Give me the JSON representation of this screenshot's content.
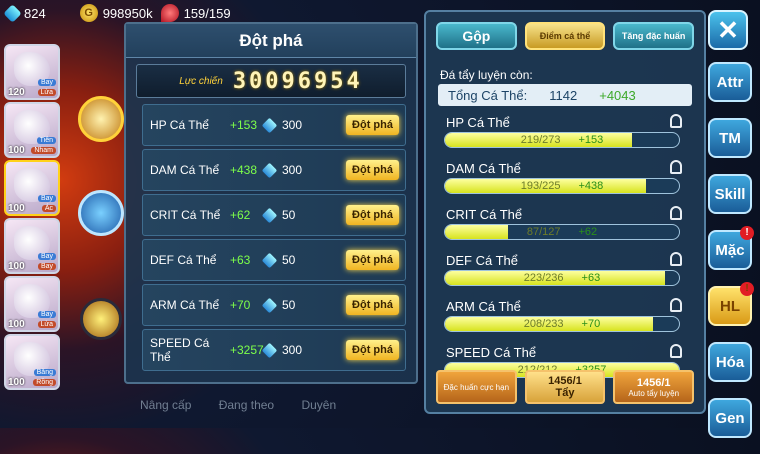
{
  "top": {
    "gems": "824",
    "gold": "998950k",
    "stamina": "159/159"
  },
  "team": [
    {
      "level": "120",
      "tag1": "Bay",
      "tag2": "Lửa"
    },
    {
      "level": "100",
      "tag1": "Tiên",
      "tag2": "Nham"
    },
    {
      "level": "100",
      "tag1": "Bay",
      "tag2": "Ác"
    },
    {
      "level": "100",
      "tag1": "Bay",
      "tag2": "Bay"
    },
    {
      "level": "100",
      "tag1": "Bay",
      "tag2": "Lửa"
    },
    {
      "level": "100",
      "tag1": "Băng",
      "tag2": "Rồng"
    }
  ],
  "left": {
    "title": "Đột phá",
    "power_label": "Lực chiến",
    "power": "30096954",
    "rows": [
      {
        "stat": "HP Cá Thể",
        "plus": "+153",
        "cost": "300",
        "btn": "Đột phá"
      },
      {
        "stat": "DAM Cá Thể",
        "plus": "+438",
        "cost": "300",
        "btn": "Đột phá"
      },
      {
        "stat": "CRIT Cá Thể",
        "plus": "+62",
        "cost": "50",
        "btn": "Đột phá"
      },
      {
        "stat": "DEF Cá Thể",
        "plus": "+63",
        "cost": "50",
        "btn": "Đột phá"
      },
      {
        "stat": "ARM Cá Thể",
        "plus": "+70",
        "cost": "50",
        "btn": "Đột phá"
      },
      {
        "stat": "SPEED Cá Thể",
        "plus": "+3257",
        "cost": "300",
        "btn": "Đột phá"
      }
    ],
    "nav": [
      "Nâng cấp",
      "Đang theo",
      "Duyên"
    ]
  },
  "right": {
    "tabs": [
      "Gộp",
      "Điểm cá thể",
      "Tăng đặc huấn"
    ],
    "heading": "Đá tẩy luyện còn:",
    "total_label": "Tổng Cá Thể:",
    "total": "1142",
    "total_plus": "+4043",
    "stats": [
      {
        "name": "HP Cá Thể",
        "val": "219/273",
        "plus": "+153",
        "fill": 0.8
      },
      {
        "name": "DAM Cá Thể",
        "val": "193/225",
        "plus": "+438",
        "fill": 0.86
      },
      {
        "name": "CRIT Cá Thể",
        "val": "87/127",
        "plus": "+62",
        "fill": 0.27
      },
      {
        "name": "DEF Cá Thể",
        "val": "223/236",
        "plus": "+63",
        "fill": 0.94
      },
      {
        "name": "ARM Cá Thể",
        "val": "208/233",
        "plus": "+70",
        "fill": 0.89
      },
      {
        "name": "SPEED Cá Thể",
        "val": "212/212",
        "plus": "+3257",
        "fill": 1.0
      }
    ],
    "foot": {
      "train": "Đặc huấn cực hạn",
      "count1": "1456/1",
      "wash": "Tẩy",
      "count2": "1456/1",
      "auto": "Auto tẩy luyện"
    }
  },
  "side": {
    "close": "✕",
    "tabs": [
      "Attr",
      "TM",
      "Skill",
      "Mặc",
      "HL",
      "Hóa",
      "Gen"
    ],
    "badges": [
      false,
      false,
      false,
      true,
      true,
      false,
      false
    ]
  }
}
